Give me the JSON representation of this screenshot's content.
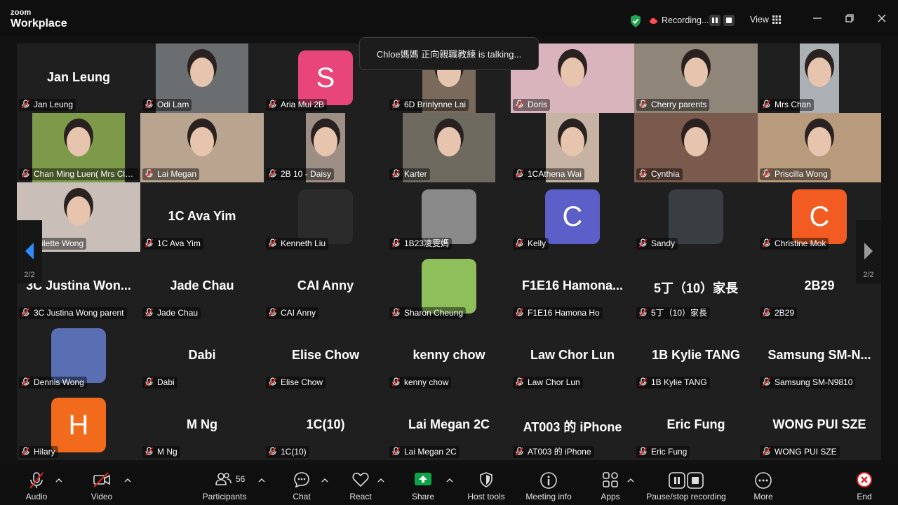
{
  "app": {
    "brand_top": "zoom",
    "brand_bottom": "Workplace"
  },
  "topbar": {
    "recording_text": "Recording...",
    "view_label": "View"
  },
  "toast": {
    "text": "Chloe媽媽 正向親職教練 is talking..."
  },
  "pager": {
    "left": "2/2",
    "right": "2/2"
  },
  "tiles": [
    {
      "label": "Jan Leung",
      "big": "Jan Leung",
      "kind": "name"
    },
    {
      "label": "Odi Lam",
      "kind": "video",
      "color": "#6b6e70"
    },
    {
      "label": "Aria Mui 2B",
      "kind": "avatar",
      "letter": "S",
      "color": "#e8457b"
    },
    {
      "label": "6D Brinlynne Lai",
      "kind": "video",
      "color": "#7a6a5c"
    },
    {
      "label": "Doris",
      "kind": "video",
      "color": "#d9b4bd"
    },
    {
      "label": "Cherry parents",
      "kind": "video",
      "color": "#8f8578"
    },
    {
      "label": "Mrs Chan",
      "kind": "video",
      "color": "#aab0b4"
    },
    {
      "label": "Chan Ming Luen( Mrs Cla...",
      "kind": "video",
      "color": "#7d9a4a"
    },
    {
      "label": "Lai Megan",
      "kind": "video",
      "color": "#b8a48f"
    },
    {
      "label": "2B 10 - Daisy",
      "kind": "video",
      "color": "#9d8e86"
    },
    {
      "label": "Karter",
      "kind": "video",
      "color": "#6e6a60"
    },
    {
      "label": "1CAthena Wai",
      "kind": "video",
      "color": "#c7b3a4"
    },
    {
      "label": "Cynthia",
      "kind": "video",
      "color": "#7a5a4c"
    },
    {
      "label": "Priscilla Wong",
      "kind": "video",
      "color": "#b89a7c"
    },
    {
      "label": "Wilette Wong",
      "kind": "video",
      "color": "#c9bfb8"
    },
    {
      "label": "1C Ava Yim",
      "big": "1C Ava Yim",
      "kind": "name"
    },
    {
      "label": "Kenneth Liu",
      "kind": "avatar",
      "letter": "",
      "color": "#2b2b2b"
    },
    {
      "label": "1B23凌雯媽",
      "kind": "avatar",
      "letter": "",
      "color": "#8a8a8a"
    },
    {
      "label": "Kelly",
      "kind": "avatar",
      "letter": "C",
      "color": "#5b5fc7"
    },
    {
      "label": "Sandy",
      "kind": "avatar",
      "letter": "",
      "color": "#3a3d42"
    },
    {
      "label": "Christine Mok",
      "kind": "avatar",
      "letter": "C",
      "color": "#f25c22"
    },
    {
      "label": "3C Justina Wong parent",
      "big": "3C Justina Won...",
      "kind": "name"
    },
    {
      "label": "Jade Chau",
      "big": "Jade Chau",
      "kind": "name"
    },
    {
      "label": "CAI Anny",
      "big": "CAI Anny",
      "kind": "name"
    },
    {
      "label": "Sharon Cheung",
      "kind": "avatar",
      "letter": "",
      "color": "#8fbf5a"
    },
    {
      "label": "F1E16 Hamona Ho",
      "big": "F1E16 Hamona...",
      "kind": "name"
    },
    {
      "label": "5丁（10）家長",
      "big": "5丁（10）家長",
      "kind": "name"
    },
    {
      "label": "2B29",
      "big": "2B29",
      "kind": "name"
    },
    {
      "label": "Dennis Wong",
      "kind": "avatar",
      "letter": "",
      "color": "#5a6fb3"
    },
    {
      "label": "Dabi",
      "big": "Dabi",
      "kind": "name"
    },
    {
      "label": "Elise Chow",
      "big": "Elise Chow",
      "kind": "name"
    },
    {
      "label": "kenny chow",
      "big": "kenny chow",
      "kind": "name"
    },
    {
      "label": "Law Chor Lun",
      "big": "Law Chor Lun",
      "kind": "name"
    },
    {
      "label": "1B Kylie TANG",
      "big": "1B Kylie TANG",
      "kind": "name"
    },
    {
      "label": "Samsung SM-N9810",
      "big": "Samsung SM-N...",
      "kind": "name"
    },
    {
      "label": "Hilary",
      "kind": "avatar",
      "letter": "H",
      "color": "#f26b1d"
    },
    {
      "label": "M Ng",
      "big": "M Ng",
      "kind": "name"
    },
    {
      "label": "1C(10)",
      "big": "1C(10)",
      "kind": "name"
    },
    {
      "label": "Lai Megan 2C",
      "big": "Lai Megan 2C",
      "kind": "name"
    },
    {
      "label": "AT003 的 iPhone",
      "big": "AT003 的 iPhone",
      "kind": "name"
    },
    {
      "label": "Eric Fung",
      "big": "Eric Fung",
      "kind": "name"
    },
    {
      "label": "WONG PUI SZE",
      "big": "WONG PUI SZE",
      "kind": "name"
    }
  ],
  "toolbar": {
    "audio": "Audio",
    "video": "Video",
    "participants": "Participants",
    "participants_count": "56",
    "chat": "Chat",
    "react": "React",
    "share": "Share",
    "host_tools": "Host tools",
    "meeting_info": "Meeting info",
    "apps": "Apps",
    "pause_stop": "Pause/stop recording",
    "more": "More",
    "end": "End"
  },
  "colors": {
    "share_green": "#0ca446",
    "end_red": "#e02828",
    "mic_red": "#e02828"
  }
}
